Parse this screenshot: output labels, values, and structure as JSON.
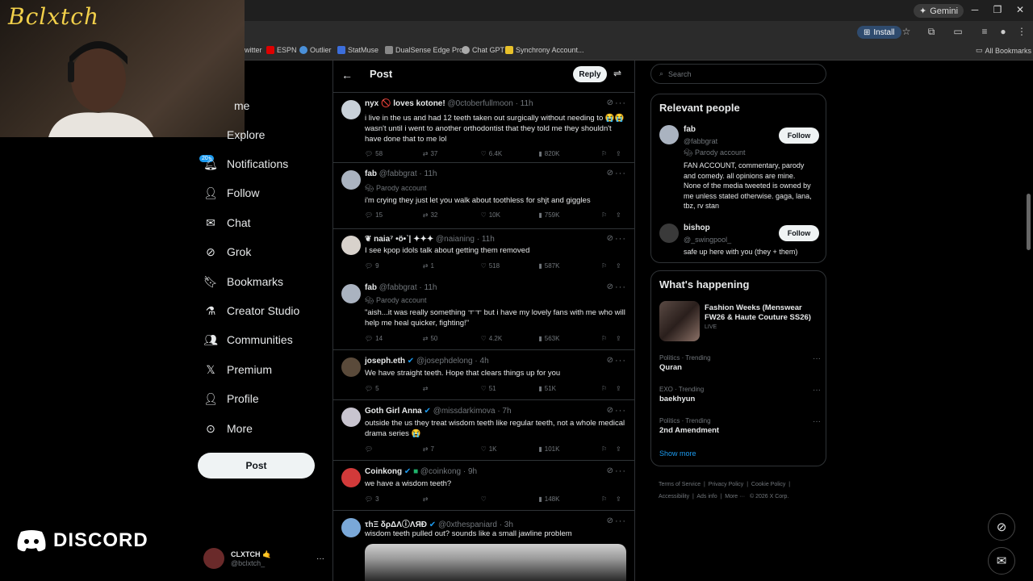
{
  "browser": {
    "gemini_label": "Gemini",
    "install_label": "Install",
    "bookmarks": [
      "witter",
      "ESPN",
      "Outlier",
      "StatMuse",
      "DualSense Edge Pro...",
      "Chat GPT",
      "Synchrony Account..."
    ],
    "all_bookmarks": "All Bookmarks"
  },
  "overlay": {
    "name": "Bclxtch",
    "discord": "DISCORD"
  },
  "nav": {
    "partial_home": "me",
    "partial_explore": "Explore",
    "badge": "20+",
    "items": [
      "Notifications",
      "Follow",
      "Chat",
      "Grok",
      "Bookmarks",
      "Creator Studio",
      "Communities",
      "Premium",
      "Profile",
      "More"
    ],
    "post_label": "Post"
  },
  "user": {
    "name": "CLXTCH",
    "emoji": "🤙",
    "handle": "@bclxtch_"
  },
  "main": {
    "title": "Post",
    "reply_label": "Reply",
    "tweets": [
      {
        "name": "nyx 🚫 loves kotone!",
        "handle": "@0ctoberfullmoon · 11h",
        "lines": [
          "i live in the us and had 12 teeth taken out surgically without needing to 😭😭",
          "wasn't until i went to another orthodontist that they told me they shouldn't",
          "have done that to me lol"
        ],
        "replies": "58",
        "reposts": "37",
        "likes": "6.4K",
        "views": "820K"
      },
      {
        "name": "fab",
        "handle": "@fabbgrat · 11h",
        "parody": "Parody account",
        "lines": [
          "i'm crying they just let you walk about toothless for shjt and giggles"
        ],
        "replies": "15",
        "reposts": "32",
        "likes": "10K",
        "views": "759K"
      },
      {
        "name": "❦ naia⁷ •ö•˺| ✦✦✦",
        "handle": "@naianing · 11h",
        "lines": [
          "I see kpop idols talk about getting them removed"
        ],
        "replies": "9",
        "reposts": "1",
        "likes": "518",
        "views": "587K"
      },
      {
        "name": "fab",
        "handle": "@fabbgrat · 11h",
        "parody": "Parody account",
        "lines": [
          "\"aish...it was really something ㅜㅜ but i have my lovely fans with me who will",
          "help me heal quicker, fighting!\""
        ],
        "replies": "14",
        "reposts": "50",
        "likes": "4.2K",
        "views": "563K"
      },
      {
        "name": "joseph.eth",
        "handle": "@josephdelong · 4h",
        "lines": [
          "We have straight teeth. Hope that clears things up for you"
        ],
        "replies": "5",
        "reposts": "",
        "likes": "51",
        "views": "51K"
      },
      {
        "name": "Goth Girl Anna",
        "handle": "@missdarkimova · 7h",
        "lines": [
          "outside the us they treat wisdom teeth like regular teeth, not a whole medical",
          "drama series 😭"
        ],
        "replies": "",
        "reposts": "7",
        "likes": "1K",
        "views": "101K"
      },
      {
        "name": "Coinkong",
        "handle": "@coinkong · 9h",
        "lines": [
          "we have a wisdom teeth?"
        ],
        "replies": "3",
        "reposts": "",
        "likes": "",
        "views": "148K"
      },
      {
        "name": "τhΞ δρΔΛⓘΛЯĐ",
        "handle": "@0xthespaniard · 3h",
        "lines": [
          "wisdom teeth pulled out? sounds like a small jawline problem"
        ]
      }
    ]
  },
  "right": {
    "search_placeholder": "Search",
    "relevant_title": "Relevant people",
    "people": [
      {
        "name": "fab",
        "handle": "@fabbgrat",
        "parody": "Parody account",
        "bio": [
          "FAN ACCOUNT, commentary, parody",
          "and comedy. all opinions are mine.",
          "None of the media tweeted is owned by",
          "me unless stated otherwise. gaga, lana,",
          "tbz, rv stan"
        ],
        "follow": "Follow"
      },
      {
        "name": "bishop",
        "handle": "@_swingpool_",
        "bio": [
          "safe up here with you (they + them)"
        ],
        "follow": "Follow"
      }
    ],
    "happening_title": "What's happening",
    "featured": {
      "title": [
        "Fashion Weeks (Menswear",
        "FW26 & Haute Couture SS26)"
      ],
      "status": "LIVE"
    },
    "trends": [
      {
        "category": "Politics · Trending",
        "title": "Quran"
      },
      {
        "category": "EXO · Trending",
        "title": "baekhyun"
      },
      {
        "category": "Politics · Trending",
        "title": "2nd Amendment"
      }
    ],
    "show_more": "Show more",
    "footer": [
      "Terms of Service",
      "Privacy Policy",
      "Cookie Policy",
      "Accessibility",
      "Ads info",
      "More ···",
      "© 2026 X Corp."
    ]
  },
  "colors": {
    "accent": "#1d9bf0",
    "background": "#000000",
    "border": "#2f3336",
    "muted": "#71767b"
  }
}
